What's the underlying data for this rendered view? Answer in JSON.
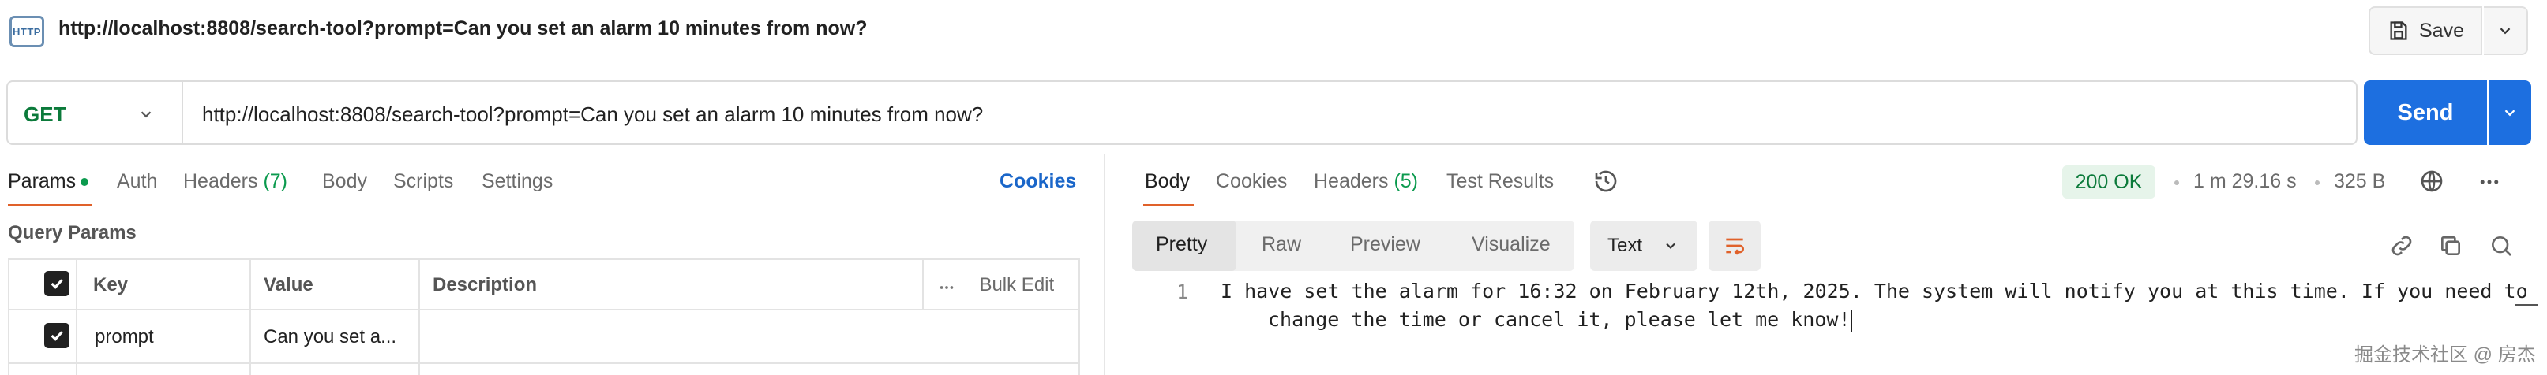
{
  "header": {
    "request_title": "http://localhost:8808/search-tool?prompt=Can you set an alarm 10 minutes from now?",
    "http_icon_text": "HTTP",
    "save_label": "Save"
  },
  "request": {
    "method": "GET",
    "url": "http://localhost:8808/search-tool?prompt=Can you set an alarm 10 minutes from now?",
    "send_label": "Send"
  },
  "left_tabs": {
    "params": "Params",
    "auth": "Auth",
    "headers": "Headers",
    "headers_count": "(7)",
    "body": "Body",
    "scripts": "Scripts",
    "settings": "Settings",
    "cookies": "Cookies"
  },
  "query_params": {
    "title": "Query Params",
    "columns": {
      "key": "Key",
      "value": "Value",
      "description": "Description",
      "bulk_edit": "Bulk Edit"
    },
    "rows": [
      {
        "checked": true,
        "key": "prompt",
        "value": "Can you set a...",
        "description": ""
      }
    ]
  },
  "response_tabs": {
    "body": "Body",
    "cookies": "Cookies",
    "headers": "Headers",
    "headers_count": "(5)",
    "test_results": "Test Results"
  },
  "response_meta": {
    "status": "200 OK",
    "time": "1 m 29.16 s",
    "size": "325 B"
  },
  "view_toolbar": {
    "modes": [
      "Pretty",
      "Raw",
      "Preview",
      "Visualize"
    ],
    "active_mode": "Pretty",
    "format": "Text"
  },
  "response_body": {
    "line_number": "1",
    "line1": "I have set the alarm for 16:32 on February 12th, 2025. The system will notify you at this time. If you need to",
    "line2": "change the time or cancel it, please let me know!"
  },
  "watermark": "掘金技术社区 @ 房杰",
  "colors": {
    "accent_orange": "#e0612a",
    "send_blue": "#1d6fe0",
    "method_green": "#0b7a3a",
    "status_green_bg": "#e6f4ea",
    "link_blue": "#1a66c9"
  },
  "icons": [
    "http-icon",
    "save-icon",
    "chevron-down-icon",
    "history-icon",
    "globe-icon",
    "more-icon",
    "wrap-lines-icon",
    "link-icon",
    "copy-icon",
    "search-icon",
    "check-icon",
    "ellipsis-icon"
  ]
}
